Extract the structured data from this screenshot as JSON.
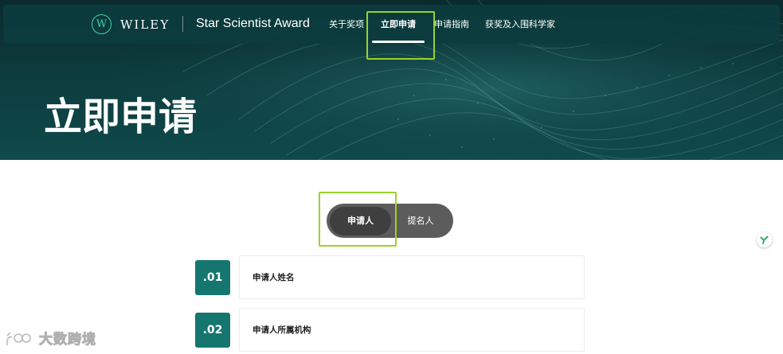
{
  "header": {
    "logo_mark": "W",
    "logo_text": "WILEY",
    "award_title": "Star Scientist Award",
    "nav": [
      {
        "label": "关于奖项",
        "active": false
      },
      {
        "label": "立即申请",
        "active": true
      },
      {
        "label": "申请指南",
        "active": false
      },
      {
        "label": "获奖及入围科学家",
        "active": false
      }
    ]
  },
  "hero": {
    "heading": "立即申请"
  },
  "toggle": {
    "active_label": "申请人",
    "other_label": "提名人"
  },
  "steps": [
    {
      "number": ".01",
      "label": "申请人姓名"
    },
    {
      "number": ".02",
      "label": "申请人所属机构"
    }
  ],
  "watermark": {
    "text": "大数跨境"
  },
  "colors": {
    "brand_teal": "#15766f",
    "logo_green": "#3fd0a6",
    "highlight": "#9ad22b",
    "toggle_bg": "#5c5c5c",
    "toggle_active": "#3f3f3f"
  },
  "icons": {
    "help_bubble": "y-check-icon",
    "watermark_logo": "watermark-logo-icon"
  }
}
